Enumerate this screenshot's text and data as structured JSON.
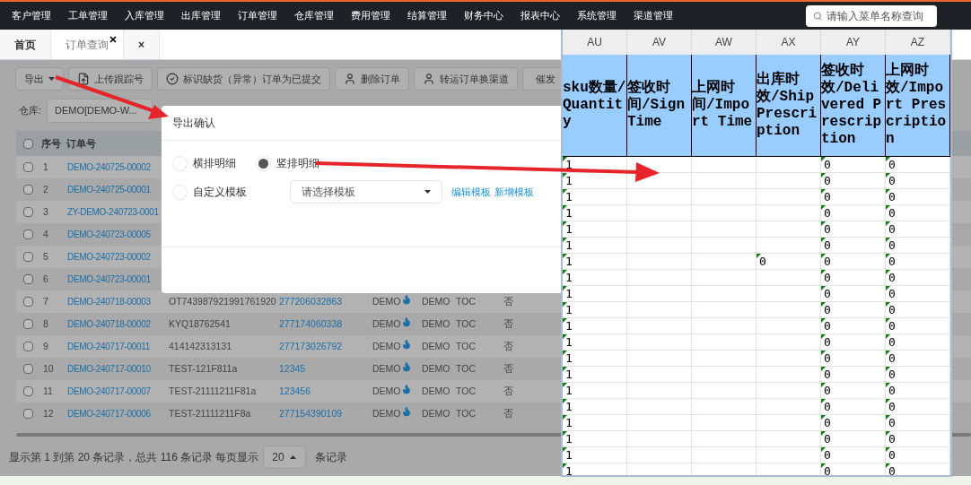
{
  "nav": {
    "items": [
      "客户管理",
      "工单管理",
      "入库管理",
      "出库管理",
      "订单管理",
      "仓库管理",
      "费用管理",
      "结算管理",
      "财务中心",
      "报表中心",
      "系统管理",
      "渠道管理"
    ],
    "search": {
      "placeholder": "请输入菜单名称查询"
    }
  },
  "tabs": [
    {
      "label": "首页",
      "selected": false,
      "closable": false
    },
    {
      "label": "订单查询",
      "selected": true,
      "closable": true
    },
    {
      "label": "×",
      "selected": false,
      "closable": false
    }
  ],
  "toolbar": [
    {
      "label": "导出",
      "kind": "dropdown"
    },
    {
      "label": "上传跟踪号",
      "kind": "upload"
    },
    {
      "label": "标识缺货（异常）订单为已提交",
      "kind": "check"
    },
    {
      "label": "删除订单",
      "kind": "user"
    },
    {
      "label": "转运订单换渠道",
      "kind": "user"
    },
    {
      "label": "催发",
      "kind": "user"
    }
  ],
  "filter": {
    "label": "仓库:",
    "value": "DEMO[DEMO-W..."
  },
  "table": {
    "all_checked": false,
    "columns": [
      "序号",
      "订单号"
    ],
    "rows": [
      {
        "no": "1",
        "order_no": "DEMO-240725-00002",
        "checked": false
      },
      {
        "no": "2",
        "order_no": "DEMO-240725-00001",
        "checked": false
      },
      {
        "no": "3",
        "order_no": "ZY-DEMO-240723-0001",
        "checked": false
      },
      {
        "no": "4",
        "order_no": "DEMO-240723-00005",
        "checked": false
      },
      {
        "no": "5",
        "order_no": "DEMO-240723-00002",
        "checked": false
      },
      {
        "no": "6",
        "order_no": "DEMO-240723-00001",
        "checked": false
      },
      {
        "no": "7",
        "order_no": "DEMO-240718-00003",
        "checked": false,
        "cells": [
          "OT743987921991761920",
          "277206032863",
          "DEMO",
          "DEMO",
          "TOC",
          "否"
        ]
      },
      {
        "no": "8",
        "order_no": "DEMO-240718-00002",
        "checked": false,
        "cells": [
          "KYQ18762541",
          "277174060338",
          "DEMO",
          "DEMO",
          "TOC",
          "否"
        ]
      },
      {
        "no": "9",
        "order_no": "DEMO-240717-00011",
        "checked": false,
        "cells": [
          "414142313131",
          "277173026792",
          "DEMO",
          "DEMO",
          "TOC",
          "否"
        ]
      },
      {
        "no": "10",
        "order_no": "DEMO-240717-00010",
        "checked": false,
        "cells": [
          "TEST-121F811a",
          "12345",
          "DEMO",
          "DEMO",
          "TOC",
          "否"
        ]
      },
      {
        "no": "11",
        "order_no": "DEMO-240717-00007",
        "checked": false,
        "cells": [
          "TEST-21111211F81a",
          "123456",
          "DEMO",
          "DEMO",
          "TOC",
          "否"
        ]
      },
      {
        "no": "12",
        "order_no": "DEMO-240717-00006",
        "checked": false,
        "cells": [
          "TEST-21111211F8a",
          "277154390109",
          "DEMO",
          "DEMO",
          "TOC",
          "否"
        ]
      }
    ]
  },
  "pagination": {
    "summary": "显示第 1 到第 20 条记录，总共 116 条记录 每页显示",
    "page_size": "20",
    "suffix": "条记录"
  },
  "dialog": {
    "title": "导出确认",
    "options": [
      {
        "label": "横排明细",
        "selected": false
      },
      {
        "label": "竖排明细",
        "selected": true
      },
      {
        "label": "自定义模板",
        "selected": false
      }
    ],
    "template_select": {
      "placeholder": "请选择模板"
    },
    "links": [
      "编辑模板",
      "新增模板"
    ]
  },
  "spreadsheet": {
    "columns": [
      {
        "letter": "AU",
        "header": "sku数量/Quantity"
      },
      {
        "letter": "AV",
        "header": "签收时间/Sign Time"
      },
      {
        "letter": "AW",
        "header": "上网时间/Import Time"
      },
      {
        "letter": "AX",
        "header": "出库时效/Ship Prescription"
      },
      {
        "letter": "AY",
        "header": "签收时效/Delivered Prescription"
      },
      {
        "letter": "AZ",
        "header": "上网时效/Import Prescription"
      }
    ],
    "rows": [
      {
        "AU": "1",
        "AY": "0",
        "AZ": "0"
      },
      {
        "AU": "1",
        "AY": "0",
        "AZ": "0"
      },
      {
        "AU": "1",
        "AY": "0",
        "AZ": "0"
      },
      {
        "AU": "1",
        "AY": "0",
        "AZ": "0"
      },
      {
        "AU": "1",
        "AY": "0",
        "AZ": "0"
      },
      {
        "AU": "1",
        "AY": "0",
        "AZ": "0"
      },
      {
        "AU": "1",
        "AX": "0",
        "AY": "0",
        "AZ": "0"
      },
      {
        "AU": "1",
        "AY": "0",
        "AZ": "0"
      },
      {
        "AU": "1",
        "AY": "0",
        "AZ": "0"
      },
      {
        "AU": "1",
        "AY": "0",
        "AZ": "0"
      },
      {
        "AU": "1",
        "AY": "0",
        "AZ": "0"
      },
      {
        "AU": "1",
        "AY": "0",
        "AZ": "0"
      },
      {
        "AU": "1",
        "AY": "0",
        "AZ": "0"
      },
      {
        "AU": "1",
        "AY": "0",
        "AZ": "0"
      },
      {
        "AU": "1",
        "AY": "0",
        "AZ": "0"
      },
      {
        "AU": "1",
        "AY": "0",
        "AZ": "0"
      },
      {
        "AU": "1",
        "AY": "0",
        "AZ": "0"
      },
      {
        "AU": "1",
        "AY": "0",
        "AZ": "0"
      },
      {
        "AU": "1",
        "AY": "0",
        "AZ": "0"
      },
      {
        "AU": "1",
        "AY": "0",
        "AZ": "0"
      }
    ]
  }
}
